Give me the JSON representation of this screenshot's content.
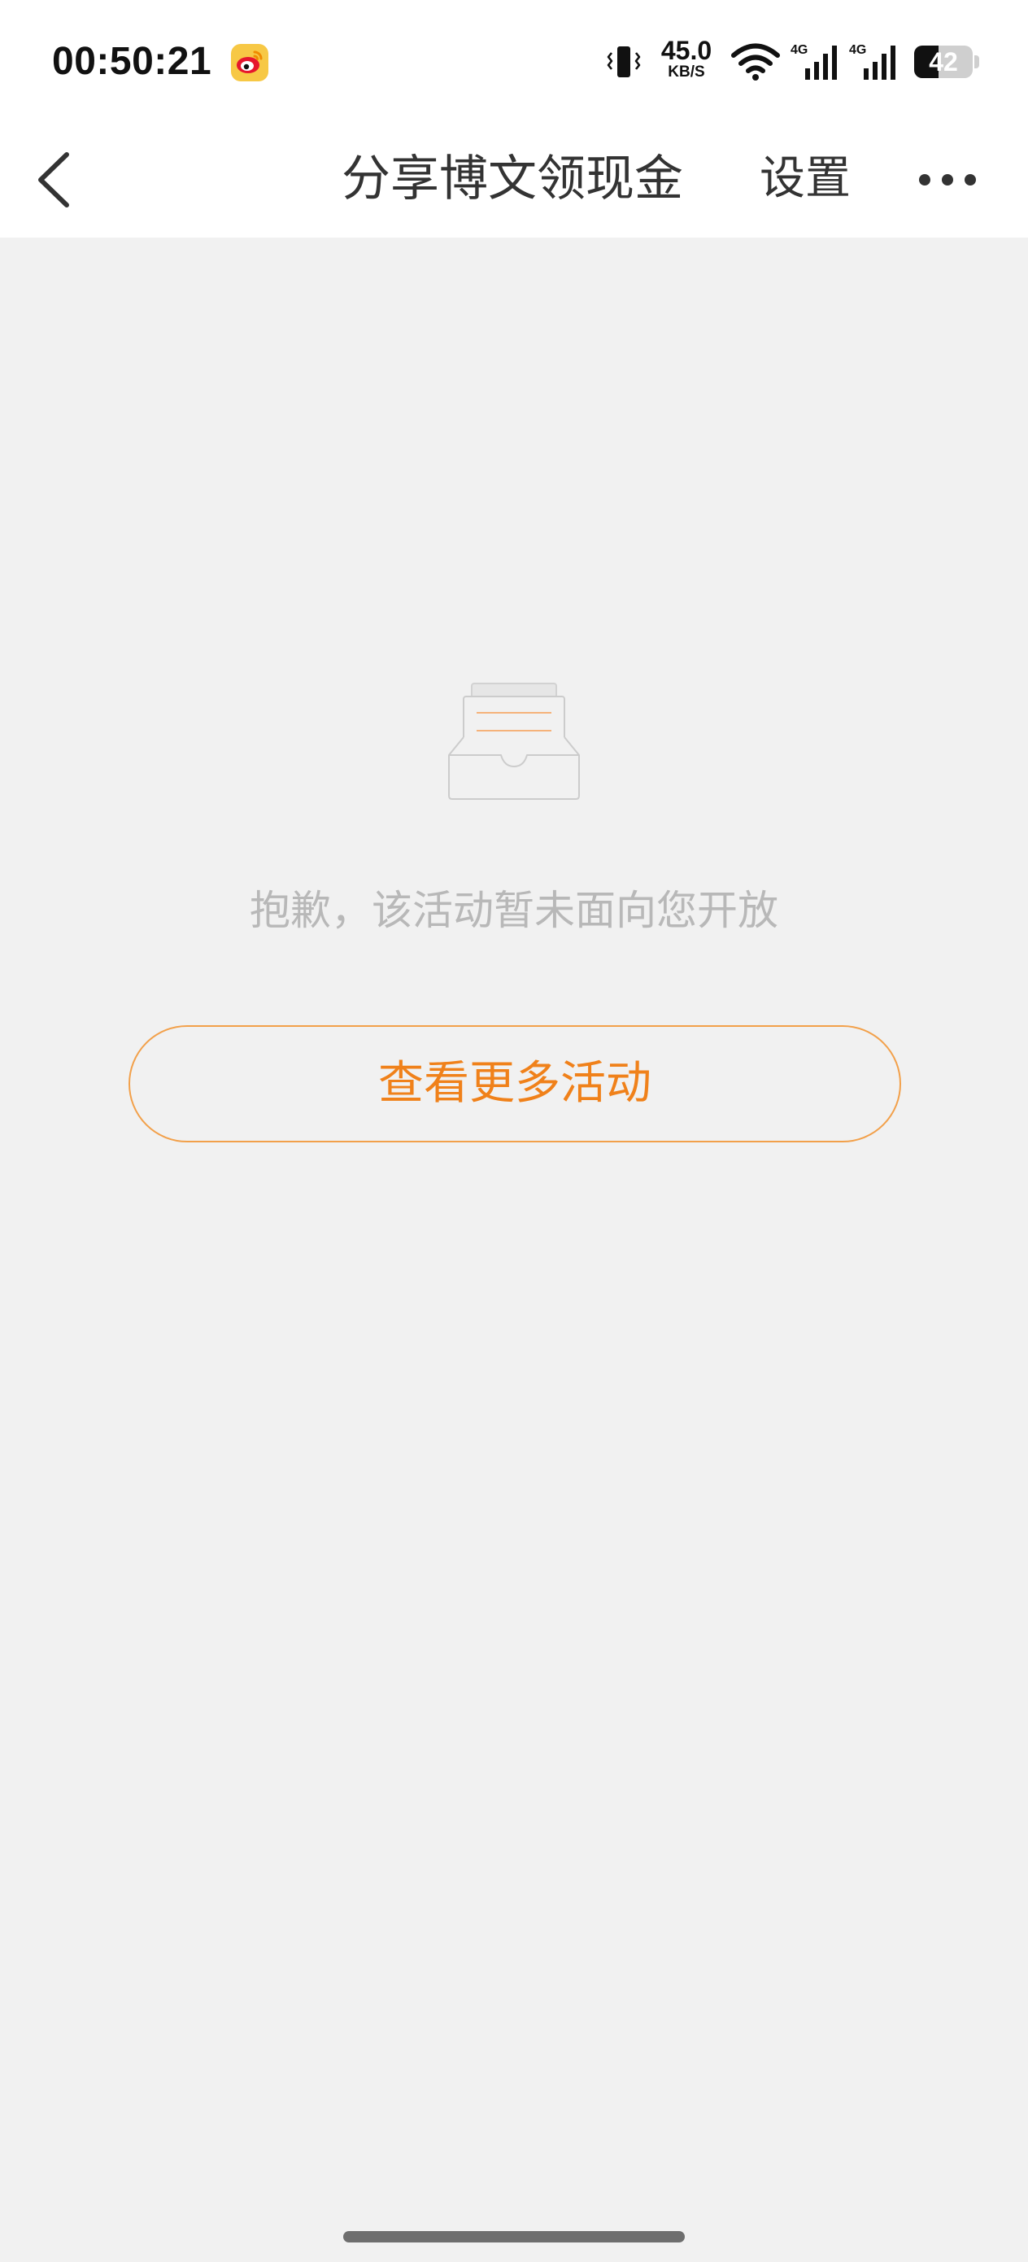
{
  "status_bar": {
    "time": "00:50:21",
    "notification_app_icon": "weibo-icon",
    "network_speed_value": "45.0",
    "network_speed_unit": "KB/S",
    "signal_labels": [
      "4G",
      "4G"
    ],
    "battery_level": "42",
    "battery_fraction": 0.42
  },
  "nav": {
    "back_icon": "chevron-left-icon",
    "title": "分享博文领现金",
    "settings_label": "设置",
    "more_icon": "more-horizontal-icon"
  },
  "content": {
    "illustration_icon": "empty-inbox-icon",
    "message": "抱歉，该活动暂未面向您开放",
    "more_activities_label": "查看更多活动"
  },
  "colors": {
    "background": "#f1f1f1",
    "bar_background": "#ffffff",
    "accent": "#f0811a",
    "button_border": "#f2a04a",
    "muted_text": "#b8b8b8",
    "title_text": "#333333"
  }
}
